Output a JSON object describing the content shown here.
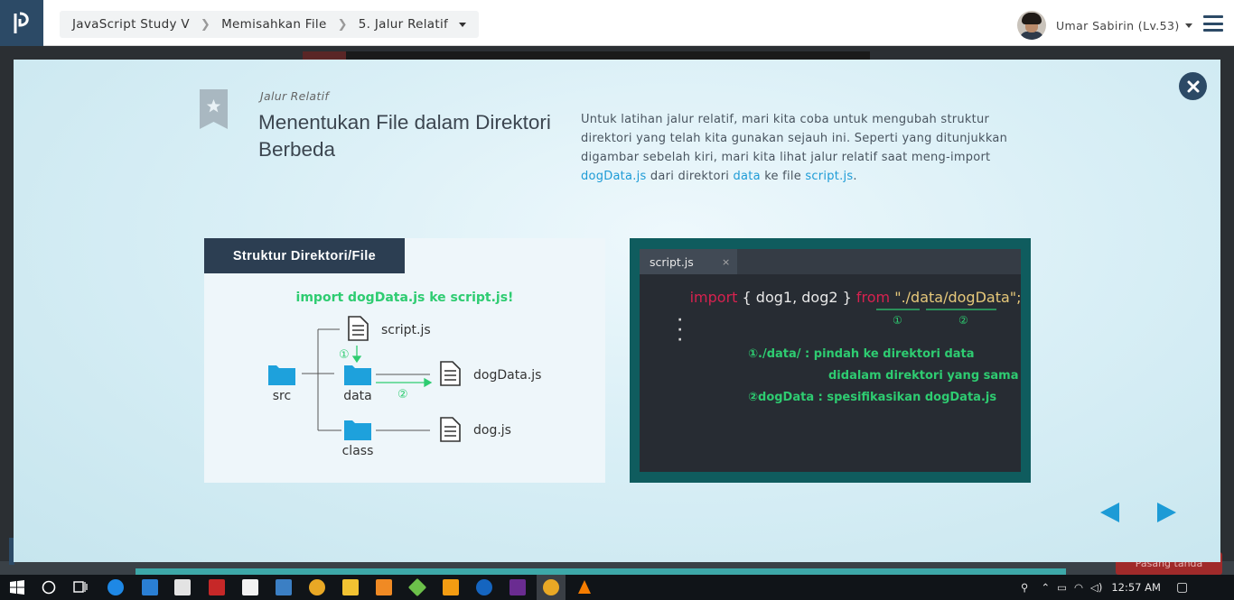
{
  "header": {
    "breadcrumbs": [
      "JavaScript Study V",
      "Memisahkan File",
      "5. Jalur Relatif"
    ],
    "user_name": "Umar Sabirin (Lv.53)"
  },
  "lesson": {
    "subtitle": "Jalur Relatif",
    "title": "Menentukan File dalam Direktori Berbeda",
    "desc_text_1": "Untuk latihan jalur relatif, mari kita coba untuk mengubah struktur direktori yang telah kita gunakan sejauh ini. Seperti yang ditunjukkan digambar sebelah kiri, mari kita lihat jalur relatif saat meng-import ",
    "desc_hl_1": "dogData.js",
    "desc_text_2": " dari direktori ",
    "desc_hl_2": "data",
    "desc_text_3": " ke file ",
    "desc_hl_3": "script.js",
    "desc_text_4": "."
  },
  "left_figure": {
    "header": "Struktur Direktori/File",
    "caption": "import dogData.js ke script.js!",
    "folders": [
      "src",
      "data",
      "class"
    ],
    "files": [
      "script.js",
      "dogData.js",
      "dog.js"
    ],
    "step_1": "①",
    "step_2": "②"
  },
  "code_figure": {
    "tab_label": "script.js",
    "tab_close": "×",
    "code_import": "import",
    "code_braces": " { dog1, dog2 } ",
    "code_from": "from",
    "code_q1": " \"",
    "code_path1": "./data/",
    "code_path2": "dogData",
    "code_q2": "\";",
    "marker_1": "①",
    "marker_2": "②",
    "dots": [
      "·",
      "·",
      "·"
    ],
    "notes": [
      "①./data/ : pindah ke direktori data",
      "didalam direktori yang sama",
      "②dogData : spesifikasikan dogData.js"
    ]
  },
  "taskbar": {
    "time": "12:57 AM"
  },
  "background": {
    "button_label": "Pasang tanda"
  },
  "colors": {
    "brand": "#2c4a66",
    "highlight": "#1d9bd6",
    "code_green": "#2ecc71",
    "code_keyword": "#d6224f",
    "code_string": "#e6c87a"
  }
}
